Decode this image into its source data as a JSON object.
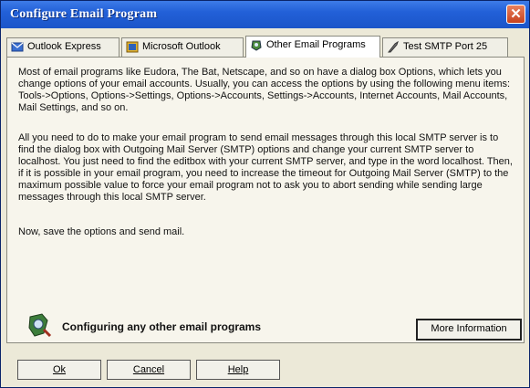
{
  "window": {
    "title": "Configure Email Program",
    "close_glyph": "✕"
  },
  "tabs": [
    {
      "label": "Outlook Express",
      "icon": "outlook-express-icon"
    },
    {
      "label": "Microsoft Outlook",
      "icon": "microsoft-outlook-icon"
    },
    {
      "label": "Other Email Programs",
      "icon": "email-program-icon",
      "active": true
    },
    {
      "label": "Test SMTP Port 25",
      "icon": "smtp-test-icon"
    }
  ],
  "content": {
    "paragraphs": [
      "Most of email programs like Eudora, The Bat, Netscape, and so on have a dialog box Options, which lets you change options of your email accounts. Usually, you can access the options by using the following menu items: Tools->Options, Options->Settings, Options->Accounts, Settings->Accounts, Internet Accounts, Mail Accounts, Mail Settings, and so on.",
      "All you need to do to make your email program to send email messages through this local SMTP server is to find the dialog box with Outgoing Mail Server (SMTP) options and change your current SMTP server to localhost. You just need to find the editbox with your current SMTP server, and type in the word localhost. Then, if it is possible in your email program, you need to increase the timeout for Outgoing Mail Server (SMTP) to the maximum possible value to force your email program not to ask you to abort sending while sending large messages through this local SMTP server.",
      "Now, save the options and send mail."
    ],
    "footer_text": "Configuring any other email programs",
    "more_info_label": "More Information"
  },
  "buttons": {
    "ok_label": "Ok",
    "cancel_label": "Cancel",
    "help_label": "Help"
  },
  "colors": {
    "titlebar": "#2260d8",
    "window_bg": "#ece9d8",
    "close_button": "#c7421e"
  }
}
